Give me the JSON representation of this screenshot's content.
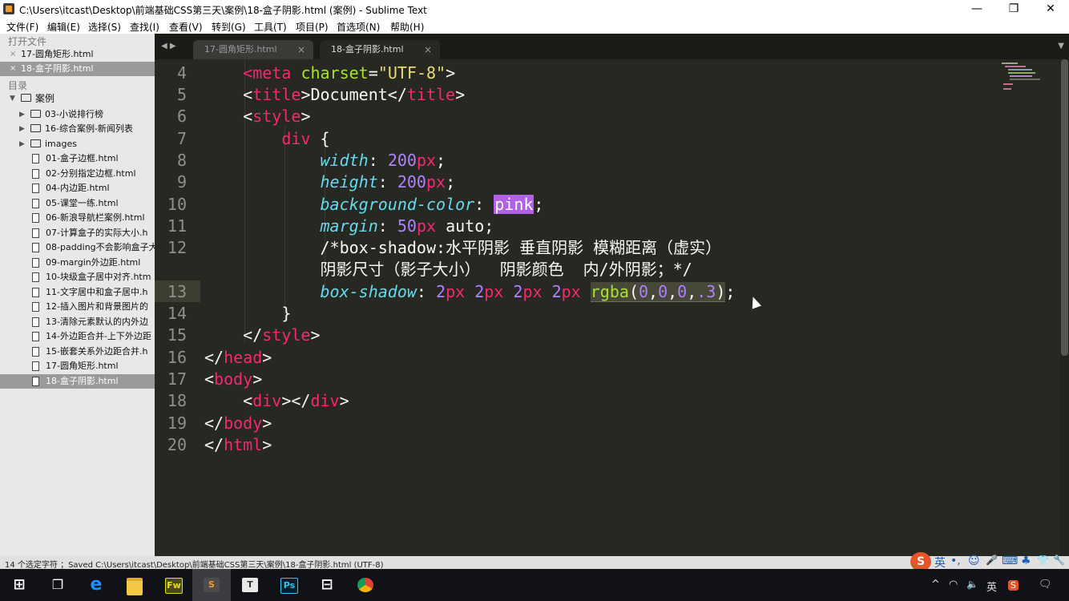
{
  "window": {
    "title": "C:\\Users\\itcast\\Desktop\\前端基础CSS第三天\\案例\\18-盒子阴影.html (案例) - Sublime Text",
    "controls": [
      "—",
      "❐",
      "✕"
    ]
  },
  "menu": [
    "文件(F)",
    "编辑(E)",
    "选择(S)",
    "查找(I)",
    "查看(V)",
    "转到(G)",
    "工具(T)",
    "项目(P)",
    "首选项(N)",
    "帮助(H)"
  ],
  "sidebar": {
    "open_files_header": "打开文件",
    "open_files": [
      {
        "close": "×",
        "label": "17-圆角矩形.html"
      },
      {
        "close": "×",
        "label": "18-盒子阴影.html"
      }
    ],
    "folders_header": "目录",
    "root": {
      "arrow": "▼",
      "label": "案例"
    },
    "folders": [
      {
        "arrow": "▶",
        "label": "03-小说排行榜"
      },
      {
        "arrow": "▶",
        "label": "16-综合案例-新闻列表"
      },
      {
        "arrow": "▶",
        "label": "images"
      }
    ],
    "files": [
      "01-盒子边框.html",
      "02-分别指定边框.html",
      "04-内边距.html",
      "05-课堂一练.html",
      "06-新浪导航栏案例.html",
      "07-计算盒子的实际大小.h",
      "08-padding不会影响盒子大",
      "09-margin外边距.html",
      "10-块级盒子居中对齐.htm",
      "11-文字居中和盒子居中.h",
      "12-插入图片和背景图片的",
      "13-清除元素默认的内外边",
      "14-外边距合并-上下外边距",
      "15-嵌套关系外边距合并.h",
      "17-圆角矩形.html",
      "18-盒子阴影.html"
    ]
  },
  "tabs": {
    "nav": "◀ ▶",
    "menu": "▼",
    "items": [
      {
        "label": "17-圆角矩形.html",
        "close": "×"
      },
      {
        "label": "18-盒子阴影.html",
        "close": "×"
      }
    ]
  },
  "editor": {
    "line_numbers": [
      "4",
      "5",
      "6",
      "7",
      "8",
      "9",
      "10",
      "11",
      "12",
      "",
      "13",
      "14",
      "15",
      "16",
      "17",
      "18",
      "19",
      "20"
    ],
    "code": {
      "l4": [
        "<",
        "meta",
        " ",
        "charset",
        "=",
        "\"UTF-8\"",
        ">"
      ],
      "l5": [
        "<",
        "title",
        ">Document</",
        "title",
        ">"
      ],
      "l6": [
        "<",
        "style",
        ">"
      ],
      "l7": [
        "div",
        " {"
      ],
      "l8": [
        "width",
        ": ",
        "200",
        "px",
        ";"
      ],
      "l9": [
        "height",
        ": ",
        "200",
        "px",
        ";"
      ],
      "l10": [
        "background-color",
        ": ",
        "pink",
        ";"
      ],
      "l11": [
        "margin",
        ": ",
        "50",
        "px",
        " auto;"
      ],
      "l12": "/*box-shadow:水平阴影 垂直阴影 模糊距离（虚实）",
      "l12b": "阴影尺寸（影子大小）  阴影颜色  内/外阴影；*/",
      "l13": [
        "box-shadow",
        ": ",
        "2",
        "px",
        " ",
        "2",
        "px",
        " ",
        "2",
        "px",
        " ",
        "2",
        "px",
        " ",
        "rgba",
        "(",
        "0",
        ",",
        "0",
        ",",
        "0",
        ",",
        ".3",
        ")",
        ";"
      ],
      "l14": "}",
      "l15": [
        "</",
        "style",
        ">"
      ],
      "l16": [
        "</",
        "head",
        ">"
      ],
      "l17": [
        "<",
        "body",
        ">"
      ],
      "l18": [
        "<",
        "div",
        "></",
        "div",
        ">"
      ],
      "l19": [
        "</",
        "body",
        ">"
      ],
      "l20": [
        "</",
        "html",
        ">"
      ]
    }
  },
  "status": "14 个选定字符 ；Saved C:\\Users\\itcast\\Desktop\\前端基础CSS第三天\\案例\\18-盒子阴影.html (UTF-8)",
  "ime": {
    "logo": "S",
    "lang": "英",
    "punct": "•,",
    "emoji": "☺",
    "mic": "🎤",
    "keyboard": "⌨",
    "skin": "♣",
    "shirt": "👕",
    "tools": "🔧"
  },
  "taskbar": {
    "apps": [
      {
        "name": "windows-start",
        "glyph": "⊞"
      },
      {
        "name": "task-view",
        "glyph": "❐"
      },
      {
        "name": "edge",
        "glyph": "e"
      },
      {
        "name": "file-explorer",
        "glyph": ""
      },
      {
        "name": "fireworks",
        "glyph": "Fw"
      },
      {
        "name": "sublime-text",
        "glyph": "S"
      },
      {
        "name": "typora",
        "glyph": "T"
      },
      {
        "name": "photoshop",
        "glyph": "Ps"
      },
      {
        "name": "xmind",
        "glyph": "⊟"
      },
      {
        "name": "chrome",
        "glyph": ""
      }
    ],
    "tray": {
      "chevron": "^",
      "wifi": "◠",
      "volume": "🔈",
      "lang": "英",
      "sogou": "S",
      "notify": "🗨"
    }
  },
  "colors": {
    "bg": "#272822",
    "tag": "#f92672",
    "string": "#e6db74",
    "attr": "#a6e22e",
    "prop": "#66d9ef",
    "number": "#ae81ff",
    "comment": "#75715e",
    "pink_highlight": "#b161e8"
  }
}
